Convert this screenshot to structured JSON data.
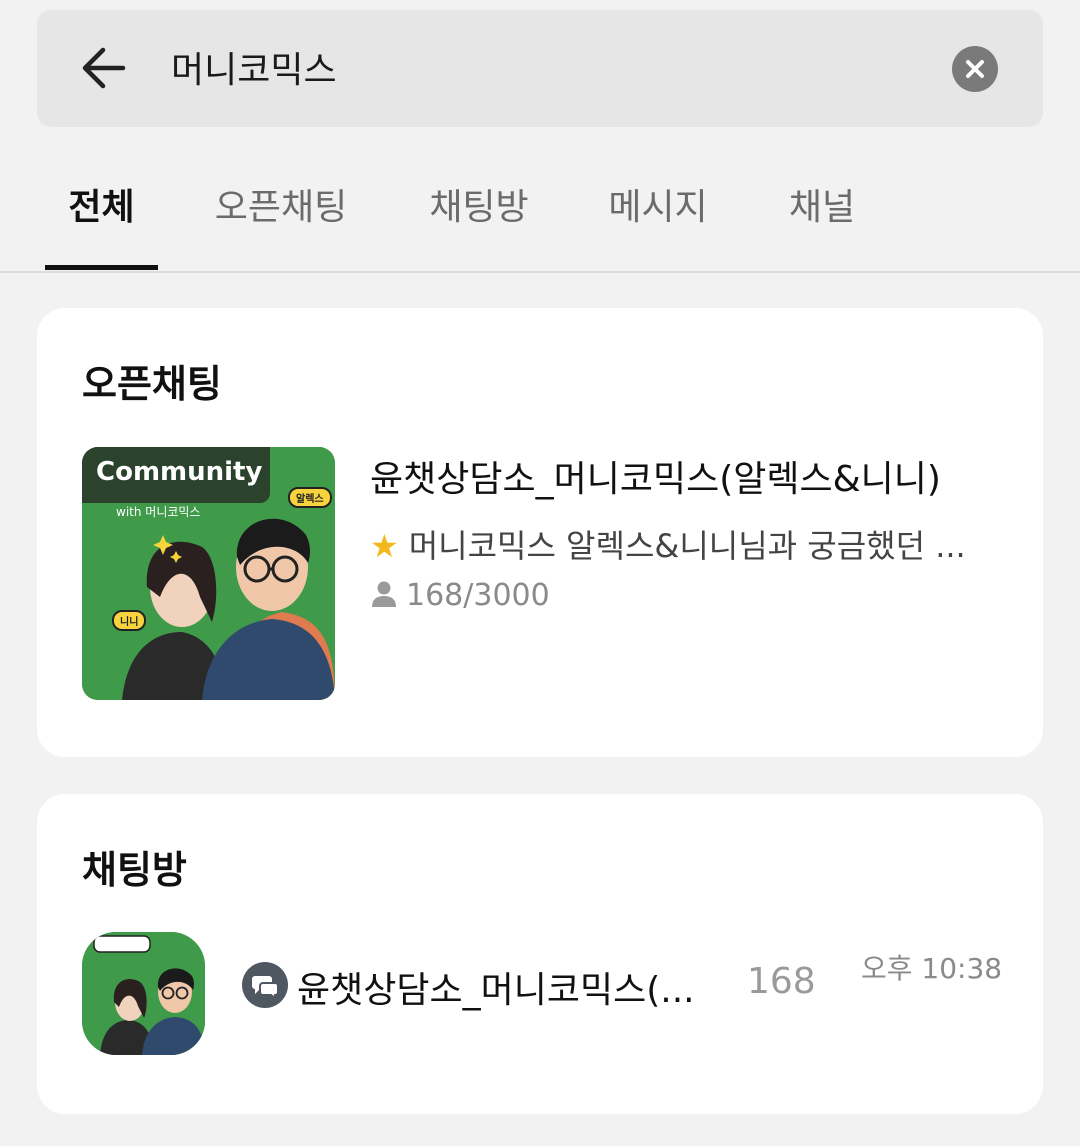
{
  "search": {
    "query": "머니코믹스"
  },
  "tabs": [
    {
      "label": "전체",
      "active": true
    },
    {
      "label": "오픈채팅",
      "active": false
    },
    {
      "label": "채팅방",
      "active": false
    },
    {
      "label": "메시지",
      "active": false
    },
    {
      "label": "채널",
      "active": false
    }
  ],
  "open_chat": {
    "section_title": "오픈채팅",
    "item": {
      "thumbnail_badge": "Community",
      "thumbnail_sub": "with 머니코믹스",
      "thumbnail_bubble_1": "알렉스",
      "thumbnail_bubble_2": "니니",
      "title": "윤챗상담소_머니코믹스(알렉스&니니)",
      "description": "머니코믹스 알렉스&니니님과 궁금했던 ...",
      "members": "168/3000",
      "icons": [
        "star-icon",
        "person-icon"
      ]
    }
  },
  "chat_rooms": {
    "section_title": "채팅방",
    "item": {
      "name": "윤챗상담소_머니코믹스(...",
      "member_count": "168",
      "time": "오후 10:38",
      "icons": [
        "open-chat-icon"
      ]
    }
  },
  "colors": {
    "background": "#f2f2f2",
    "search_bar": "#e6e6e6",
    "card": "#ffffff",
    "thumbnail_green": "#3f9a4a",
    "star": "#f5b81c"
  }
}
